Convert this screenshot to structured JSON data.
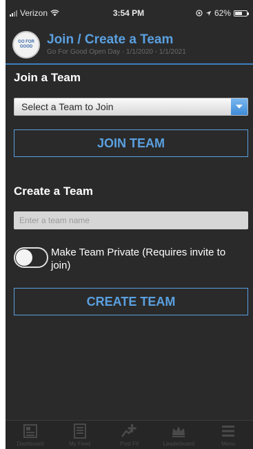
{
  "status_bar": {
    "carrier": "Verizon",
    "time": "3:54 PM",
    "battery": "62%",
    "battery_level": 0.62
  },
  "header": {
    "title": "Join / Create a Team",
    "subtitle": "Go For Good Open Day · 1/1/2020 - 1/1/2021"
  },
  "join": {
    "section_title": "Join a Team",
    "select_value": "Select a Team to Join",
    "button_label": "JOIN TEAM"
  },
  "create": {
    "section_title": "Create a Team",
    "input_placeholder": "Enter a team name",
    "input_value": "",
    "private_label": "Make Team Private (Requires invite to join)",
    "private_enabled": false,
    "button_label": "CREATE TEAM"
  },
  "tabs": [
    {
      "icon": "dashboard-icon",
      "label": "Dashboard"
    },
    {
      "icon": "list-icon",
      "label": "My Feed"
    },
    {
      "icon": "add-activity-icon",
      "label": "Post Fit"
    },
    {
      "icon": "crown-icon",
      "label": "Leaderboard"
    },
    {
      "icon": "menu-icon",
      "label": "Menu"
    }
  ],
  "colors": {
    "accent": "#5aa0e0",
    "background": "#2a2a2a",
    "header_rule": "#3d7ec0"
  }
}
